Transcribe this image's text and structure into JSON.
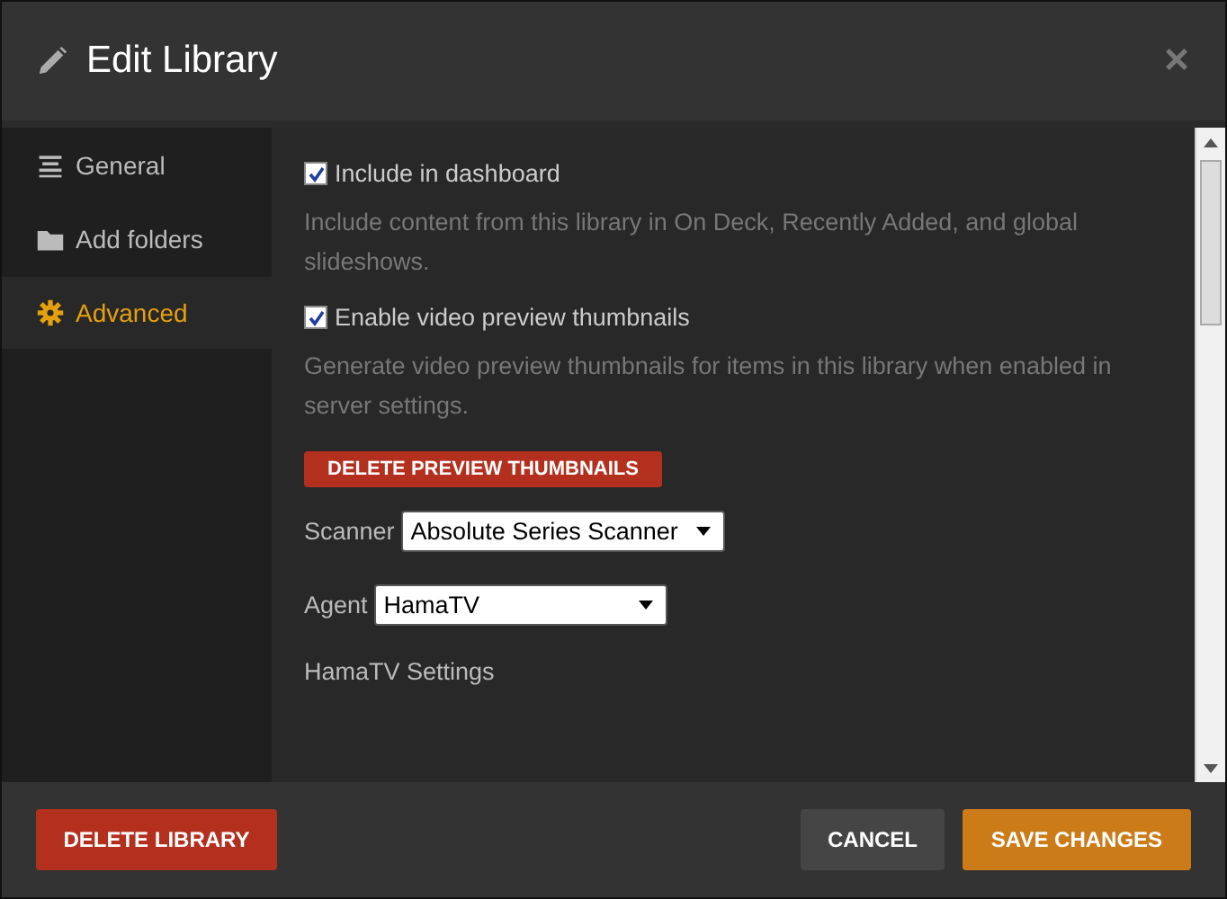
{
  "dialog": {
    "title": "Edit Library",
    "close": "×"
  },
  "sidebar": {
    "items": [
      {
        "kind": "lines",
        "label": "General",
        "selected": false
      },
      {
        "kind": "folder",
        "label": "Add folders",
        "selected": false
      },
      {
        "kind": "gear",
        "label": "Advanced",
        "selected": true
      }
    ]
  },
  "settings": [
    {
      "kind": "checkbox",
      "label": "Include in dashboard",
      "checked": true,
      "description": "Include content from this library in On Deck, Recently Added, and global slideshows."
    },
    {
      "kind": "checkbox",
      "label": "Enable video preview thumbnails",
      "checked": true,
      "description": "Generate video preview thumbnails for items in this library when enabled in server settings."
    },
    {
      "kind": "button",
      "label": "DELETE PREVIEW THUMBNAILS"
    },
    {
      "kind": "select",
      "label": "Scanner",
      "value": "Absolute Series Scanner"
    },
    {
      "kind": "select",
      "label": "Agent",
      "value": "HamaTV"
    },
    {
      "kind": "heading",
      "label": "HamaTV Settings"
    }
  ],
  "footer": {
    "buttons": [
      {
        "kind": "danger",
        "label": "DELETE LIBRARY"
      },
      {
        "kind": "neutral",
        "label": "CANCEL"
      },
      {
        "kind": "primary",
        "label": "SAVE CHANGES"
      }
    ]
  }
}
